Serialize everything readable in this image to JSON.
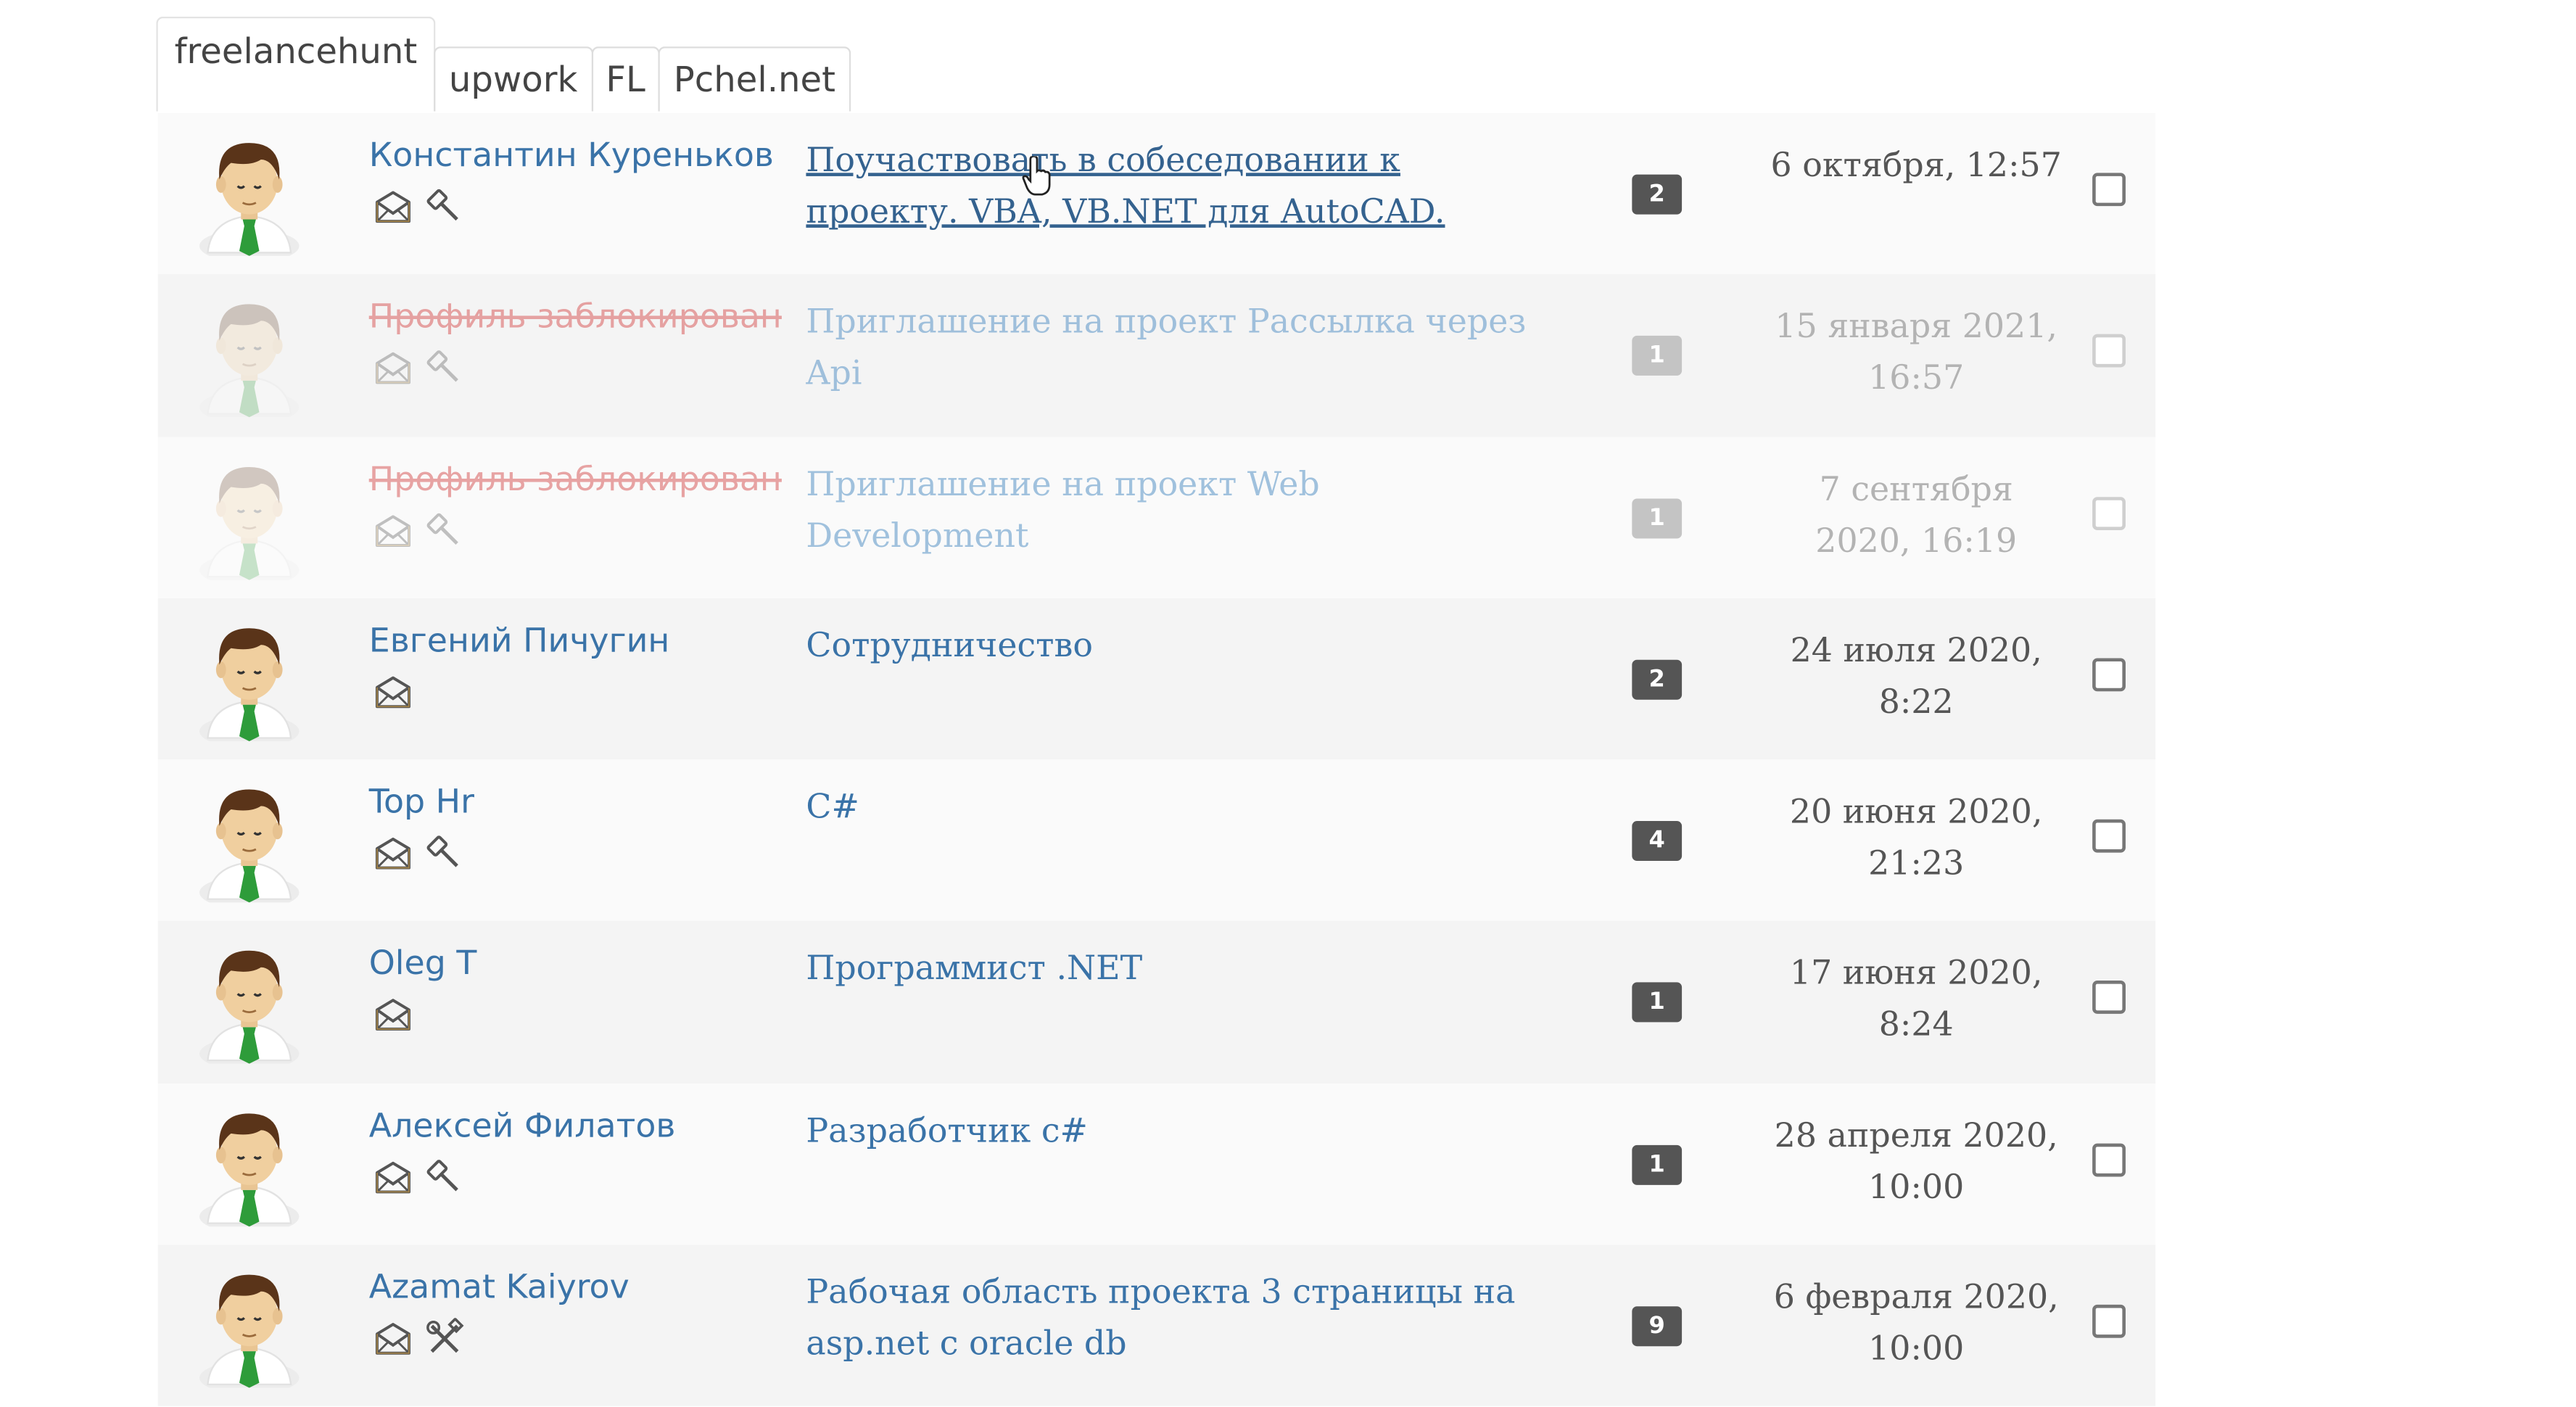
{
  "tabs": [
    {
      "label": "freelancehunt",
      "active": true
    },
    {
      "label": "upwork",
      "active": false
    },
    {
      "label": "FL",
      "active": false
    },
    {
      "label": "Pchel.net",
      "active": false
    }
  ],
  "rows": [
    {
      "name": "Константин Куреньков",
      "subject": "Поучаствовать в собеседовании к проекту. VBA, VB.NET для AutoCAD.",
      "count": "2",
      "date": "6 октября, 12:57",
      "icons": [
        "envelope-icon",
        "gavel-icon"
      ],
      "blocked": false
    },
    {
      "name": "Профиль заблокирован",
      "subject": "Приглашение на проект Рассылка через Api",
      "count": "1",
      "date": "15 января 2021, 16:57",
      "icons": [
        "envelope-icon",
        "gavel-icon"
      ],
      "blocked": true
    },
    {
      "name": "Профиль заблокирован",
      "subject": "Приглашение на проект Web Development",
      "count": "1",
      "date": "7 сентября 2020, 16:19",
      "icons": [
        "envelope-icon",
        "gavel-icon"
      ],
      "blocked": true
    },
    {
      "name": "Евгений Пичугин",
      "subject": "Сотрудничество",
      "count": "2",
      "date": "24 июля 2020, 8:22",
      "icons": [
        "envelope-icon"
      ],
      "blocked": false
    },
    {
      "name": "Top Hr",
      "subject": "C#",
      "count": "4",
      "date": "20 июня 2020, 21:23",
      "icons": [
        "envelope-icon",
        "gavel-icon"
      ],
      "blocked": false
    },
    {
      "name": "Oleg T",
      "subject": "Программист .NET",
      "count": "1",
      "date": "17 июня 2020, 8:24",
      "icons": [
        "envelope-icon"
      ],
      "blocked": false
    },
    {
      "name": "Алексей Филатов",
      "subject": "Разработчик c#",
      "count": "1",
      "date": "28 апреля 2020, 10:00",
      "icons": [
        "envelope-icon",
        "gavel-icon"
      ],
      "blocked": false
    },
    {
      "name": "Azamat Kaiyrov",
      "subject": "Рабочая область проекта 3 страницы на asp.net с oracle db",
      "count": "9",
      "date": "6 февраля 2020, 10:00",
      "icons": [
        "envelope-icon",
        "tools-icon"
      ],
      "blocked": false
    }
  ],
  "colors": {
    "link": "#3a73a8",
    "blocked_name": "#e07f7f",
    "badge": "#555555",
    "row_odd": "#fafafa",
    "row_even": "#f4f4f4"
  }
}
